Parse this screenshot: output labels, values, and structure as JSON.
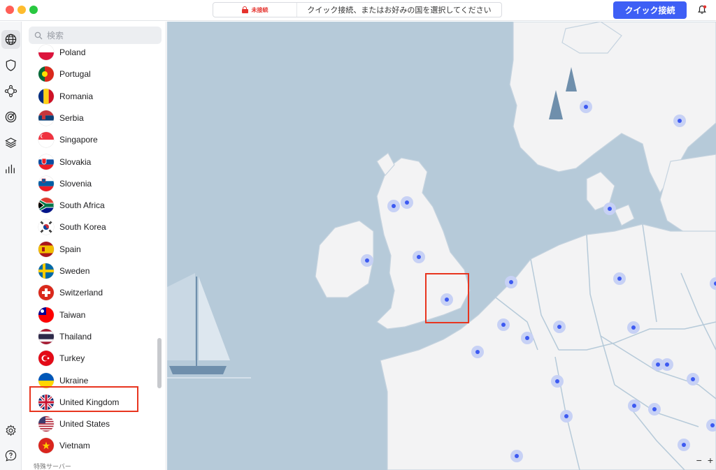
{
  "window": {
    "status": {
      "label": "未接続",
      "message": "クイック接続、またはお好みの国を選択してください"
    },
    "quick_connect_label": "クイック接続"
  },
  "sidebar": {
    "search": {
      "placeholder": "検索"
    },
    "countries": [
      {
        "name": "Poland",
        "flag": "poland"
      },
      {
        "name": "Portugal",
        "flag": "portugal"
      },
      {
        "name": "Romania",
        "flag": "romania"
      },
      {
        "name": "Serbia",
        "flag": "serbia"
      },
      {
        "name": "Singapore",
        "flag": "singapore"
      },
      {
        "name": "Slovakia",
        "flag": "slovakia"
      },
      {
        "name": "Slovenia",
        "flag": "slovenia"
      },
      {
        "name": "South Africa",
        "flag": "south-africa"
      },
      {
        "name": "South Korea",
        "flag": "south-korea"
      },
      {
        "name": "Spain",
        "flag": "spain"
      },
      {
        "name": "Sweden",
        "flag": "sweden"
      },
      {
        "name": "Switzerland",
        "flag": "switzerland"
      },
      {
        "name": "Taiwan",
        "flag": "taiwan"
      },
      {
        "name": "Thailand",
        "flag": "thailand"
      },
      {
        "name": "Turkey",
        "flag": "turkey"
      },
      {
        "name": "Ukraine",
        "flag": "ukraine"
      },
      {
        "name": "United Kingdom",
        "flag": "united-kingdom"
      },
      {
        "name": "United States",
        "flag": "united-states"
      },
      {
        "name": "Vietnam",
        "flag": "vietnam"
      }
    ],
    "section_label": "特殊サーバー"
  },
  "rail": {
    "items": [
      {
        "icon": "globe-icon",
        "active": true
      },
      {
        "icon": "shield-icon",
        "active": false
      },
      {
        "icon": "meshnet-icon",
        "active": false
      },
      {
        "icon": "target-icon",
        "active": false
      },
      {
        "icon": "layers-icon",
        "active": false
      },
      {
        "icon": "stats-icon",
        "active": false
      }
    ],
    "bottom": [
      {
        "icon": "settings-icon"
      },
      {
        "icon": "help-icon"
      }
    ]
  },
  "map": {
    "zoom_out": "−",
    "zoom_in": "+"
  },
  "colors": {
    "accent": "#3e5ff5",
    "sea": "#b6cad9",
    "land": "#f3f3f4",
    "dot": "#3d5af1",
    "highlight": "#e8351f",
    "disconnected": "#e5322d"
  }
}
